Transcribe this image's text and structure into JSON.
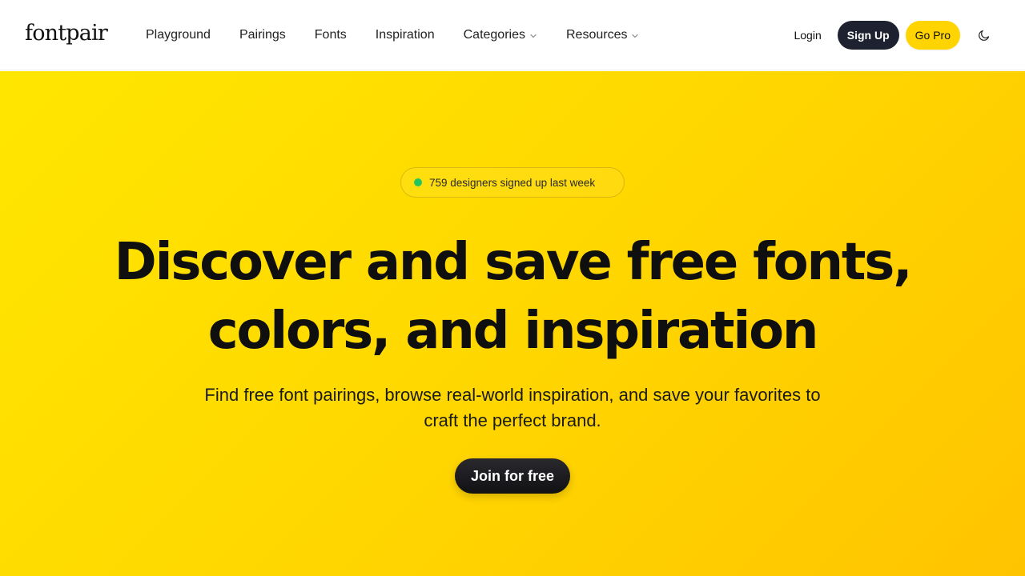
{
  "header": {
    "logo": "fontpair",
    "nav": [
      {
        "label": "Playground",
        "has_dropdown": false
      },
      {
        "label": "Pairings",
        "has_dropdown": false
      },
      {
        "label": "Fonts",
        "has_dropdown": false
      },
      {
        "label": "Inspiration",
        "has_dropdown": false
      },
      {
        "label": "Categories",
        "has_dropdown": true
      },
      {
        "label": "Resources",
        "has_dropdown": true
      }
    ],
    "login_label": "Login",
    "signup_label": "Sign Up",
    "gopro_label": "Go Pro",
    "theme_icon": "moon-icon"
  },
  "hero": {
    "badge_text": "759 designers signed up last week",
    "headline_line1": "Discover and save free fonts,",
    "headline_line2": "colors, and inspiration",
    "subtext_line1": "Find free font pairings, browse real-world inspiration, and save your favorites to",
    "subtext_line2": "craft the perfect brand.",
    "cta_label": "Join for free"
  },
  "colors": {
    "hero_gradient_start": "#ffe600",
    "hero_gradient_end": "#ffc400",
    "signup_bg": "#1e2230",
    "gopro_bg": "#ffd400",
    "badge_dot": "#22c55e",
    "cta_bg": "#111114"
  }
}
